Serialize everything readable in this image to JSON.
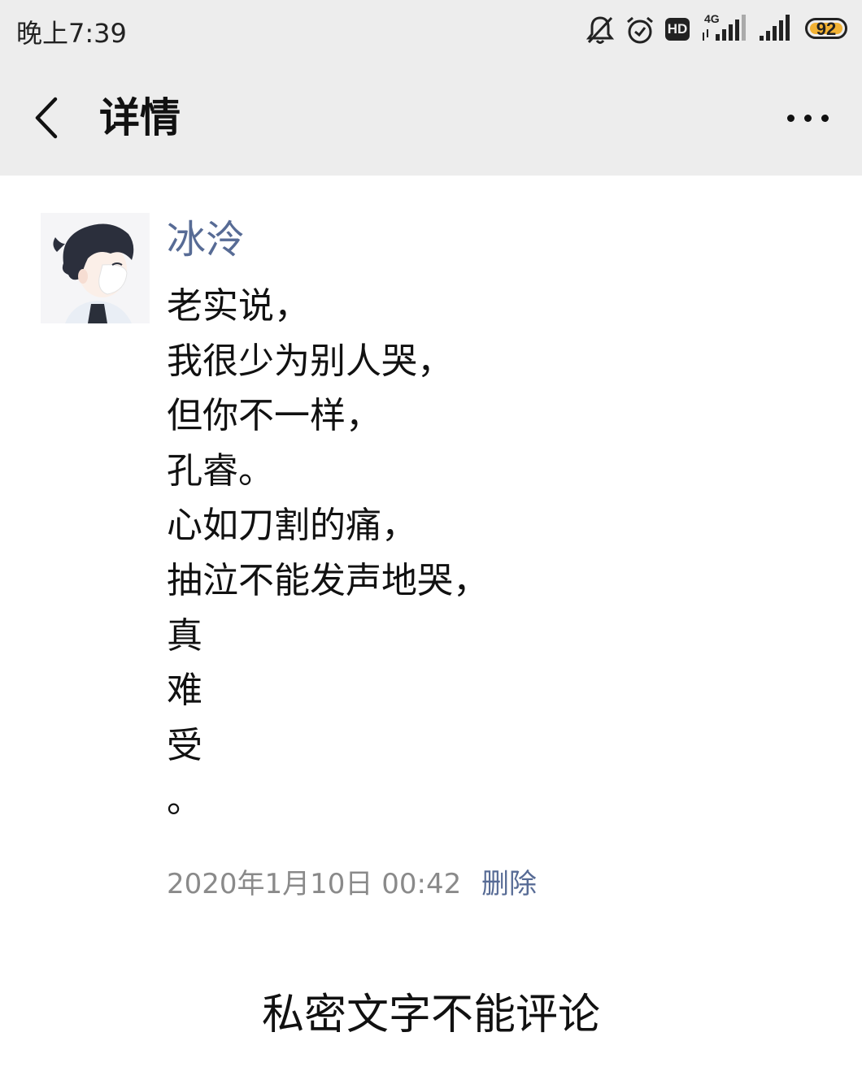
{
  "status_bar": {
    "time": "晚上7:39",
    "icons": [
      "bell-muted-icon",
      "alarm-clock-icon",
      "hd-icon",
      "signal-4g-icon",
      "signal-icon",
      "battery-icon"
    ],
    "hd_label": "HD",
    "network_label": "4G",
    "battery_level": "92",
    "battery_color": "#f2b234"
  },
  "nav": {
    "back_icon": "chevron-left-icon",
    "title": "详情",
    "more_icon": "more-dots-icon"
  },
  "post": {
    "author": "冰泠",
    "author_color": "#576b95",
    "lines": [
      "老实说，",
      "我很少为别人哭，",
      "但你不一样，",
      "孔睿。",
      "心如刀割的痛，",
      "抽泣不能发声地哭，",
      "真",
      "难",
      "受",
      "。"
    ],
    "timestamp": "2020年1月10日 00:42",
    "delete_label": "删除"
  },
  "footer": {
    "notice": "私密文字不能评论"
  }
}
